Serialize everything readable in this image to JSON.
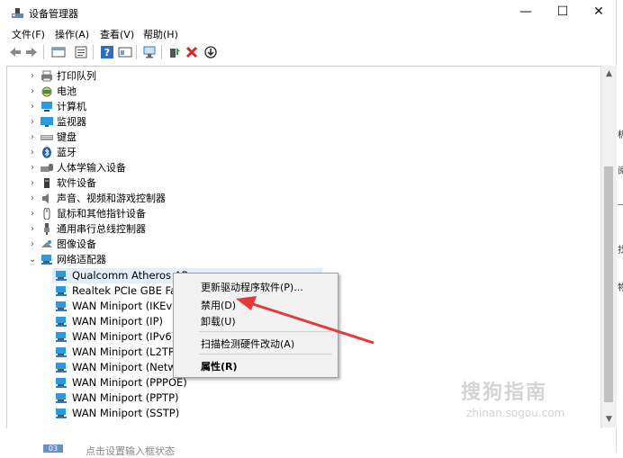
{
  "window": {
    "title": "设备管理器",
    "controls": {
      "minimize": "—",
      "maximize": "☐",
      "close": "✕"
    }
  },
  "menubar": [
    "文件(F)",
    "操作(A)",
    "查看(V)",
    "帮助(H)"
  ],
  "tree": {
    "categories": [
      {
        "label": "打印队列",
        "icon": "printer-icon",
        "expanded": false
      },
      {
        "label": "电池",
        "icon": "battery-icon",
        "expanded": false
      },
      {
        "label": "计算机",
        "icon": "computer-icon",
        "expanded": false
      },
      {
        "label": "监视器",
        "icon": "monitor-icon",
        "expanded": false
      },
      {
        "label": "键盘",
        "icon": "keyboard-icon",
        "expanded": false
      },
      {
        "label": "蓝牙",
        "icon": "bluetooth-icon",
        "expanded": false
      },
      {
        "label": "人体学输入设备",
        "icon": "hid-icon",
        "expanded": false
      },
      {
        "label": "软件设备",
        "icon": "software-device-icon",
        "expanded": false
      },
      {
        "label": "声音、视频和游戏控制器",
        "icon": "speaker-icon",
        "expanded": false
      },
      {
        "label": "鼠标和其他指针设备",
        "icon": "mouse-icon",
        "expanded": false
      },
      {
        "label": "通用串行总线控制器",
        "icon": "usb-icon",
        "expanded": false
      },
      {
        "label": "图像设备",
        "icon": "camera-icon",
        "expanded": false
      },
      {
        "label": "网络适配器",
        "icon": "network-adapter-icon",
        "expanded": true
      }
    ],
    "network_adapters": [
      "Qualcomm Atheros AR",
      "Realtek PCIe GBE Fami",
      "WAN Miniport (IKEv2)",
      "WAN Miniport (IP)",
      "WAN Miniport (IPv6)",
      "WAN Miniport (L2TP)",
      "WAN Miniport (Netwo",
      "WAN Miniport (PPPOE)",
      "WAN Miniport (PPTP)",
      "WAN Miniport (SSTP)"
    ]
  },
  "context_menu": {
    "update_driver": "更新驱动程序软件(P)...",
    "disable": "禁用(D)",
    "uninstall": "卸载(U)",
    "scan": "扫描检测硬件改动(A)",
    "properties": "属性(R)"
  },
  "watermark": {
    "brand": "搜狗指南",
    "url": "zhinan.sogou.com"
  },
  "bottom": {
    "badge": "03",
    "text": "点击设置输入框状态"
  },
  "right_strip_chars": [
    "析",
    "阅",
    "—",
    "找",
    "物"
  ],
  "colors": {
    "accent_arrow": "#e53a3a",
    "selection": "#e4eefb",
    "folder_blue": "#2b7bc4"
  }
}
